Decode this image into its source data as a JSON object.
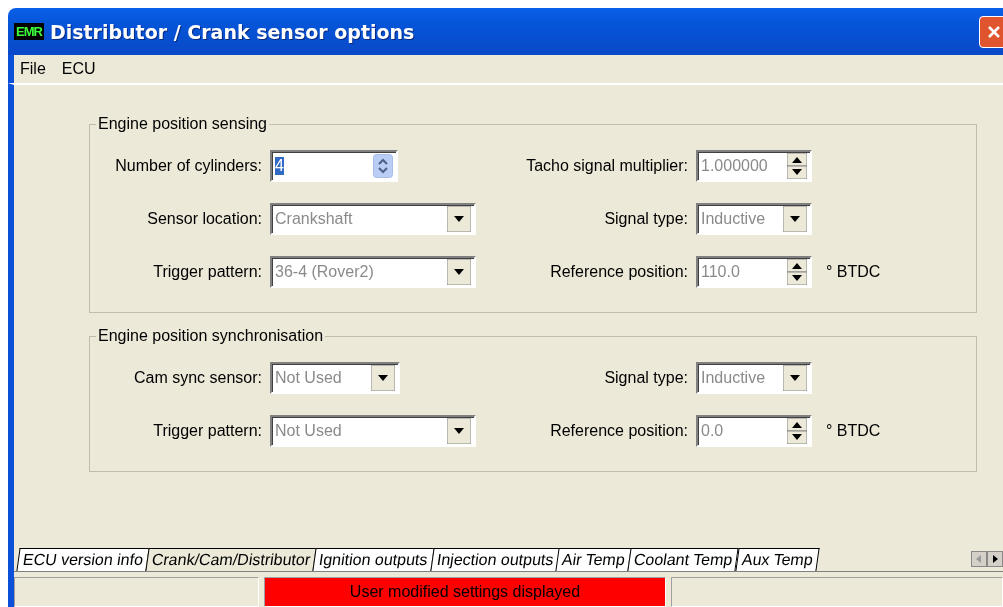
{
  "window": {
    "title": "Distributor / Crank sensor options",
    "app_badge": "EMR"
  },
  "menu": [
    {
      "label": "File"
    },
    {
      "label": "ECU"
    }
  ],
  "groups": [
    {
      "title": "Engine position sensing",
      "rows": [
        [
          {
            "label": "Number of cylinders:",
            "kind": "spin",
            "value": "4",
            "disabled": false,
            "value_selected": true
          },
          {
            "label": "Tacho signal multiplier:",
            "kind": "spin",
            "value": "1.000000",
            "disabled": true,
            "value_selected": false
          }
        ],
        [
          {
            "label": "Sensor location:",
            "kind": "dropdown",
            "value": "Crankshaft",
            "disabled": true,
            "value_selected": false
          },
          {
            "label": "Signal type:",
            "kind": "dropdown",
            "value": "Inductive",
            "disabled": true,
            "value_selected": false
          }
        ],
        [
          {
            "label": "Trigger pattern:",
            "kind": "dropdown",
            "value": "36-4 (Rover2)",
            "disabled": true,
            "value_selected": false
          },
          {
            "label": "Reference position:",
            "kind": "spin",
            "value": "110.0",
            "disabled": true,
            "value_selected": false,
            "unit": "° BTDC"
          }
        ]
      ]
    },
    {
      "title": "Engine position synchronisation",
      "rows": [
        [
          {
            "label": "Cam sync sensor:",
            "kind": "dropdown",
            "value": "Not Used",
            "disabled": true,
            "value_selected": false
          },
          {
            "label": "Signal type:",
            "kind": "dropdown",
            "value": "Inductive",
            "disabled": true,
            "value_selected": false
          }
        ],
        [
          {
            "label": "Trigger pattern:",
            "kind": "dropdown",
            "value": "Not Used",
            "disabled": true,
            "value_selected": false
          },
          {
            "label": "Reference position:",
            "kind": "spin",
            "value": "0.0",
            "disabled": true,
            "value_selected": false,
            "unit": "° BTDC"
          }
        ]
      ]
    }
  ],
  "tabs": [
    {
      "label": "ECU version info",
      "selected": false
    },
    {
      "label": "Crank/Cam/Distributor",
      "selected": true
    },
    {
      "label": "Ignition outputs",
      "selected": false
    },
    {
      "label": "Injection outputs",
      "selected": false
    },
    {
      "label": "Air Temp",
      "selected": false
    },
    {
      "label": "Coolant Temp",
      "selected": false
    },
    {
      "label": "Aux Temp",
      "selected": false
    }
  ],
  "status_bar": {
    "message": "User modified settings displayed",
    "highlighted": true
  }
}
